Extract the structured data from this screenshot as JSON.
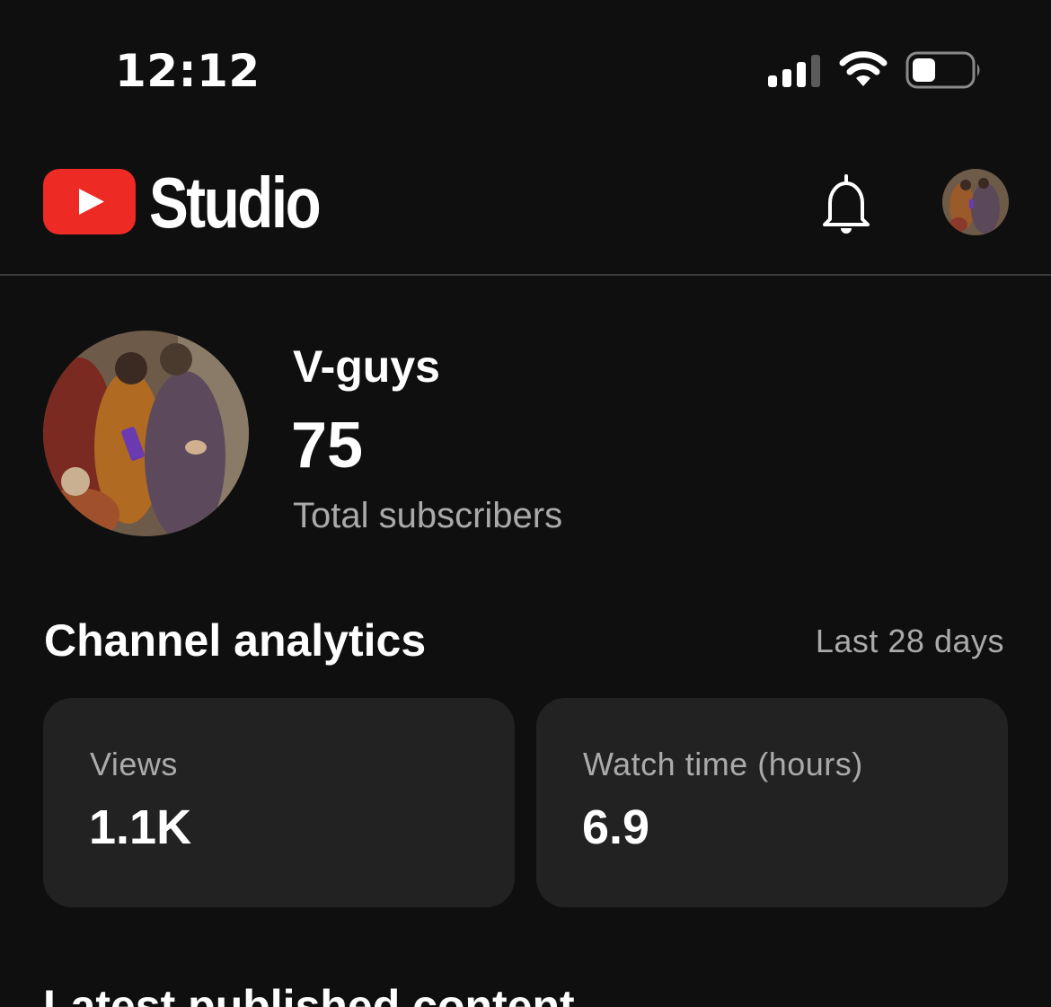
{
  "status_bar": {
    "time": "12:12",
    "icons": [
      "signal-icon",
      "wifi-icon",
      "battery-icon"
    ],
    "battery_level": 0.4
  },
  "header": {
    "logo_text": "Studio",
    "brand_color": "#ff0000",
    "icons": [
      "youtube-logo-icon",
      "bell-icon",
      "avatar"
    ]
  },
  "channel": {
    "name": "V-guys",
    "subscribers": "75",
    "subscribers_label": "Total subscribers"
  },
  "analytics": {
    "title": "Channel analytics",
    "period": "Last 28 days",
    "cards": [
      {
        "label": "Views",
        "value": "1.1K"
      },
      {
        "label": "Watch time (hours)",
        "value": "6.9"
      }
    ]
  },
  "latest": {
    "title": "Latest published content"
  },
  "colors": {
    "background": "#0f0f0f",
    "card": "#222222",
    "secondary_text": "#aaaaaa"
  }
}
